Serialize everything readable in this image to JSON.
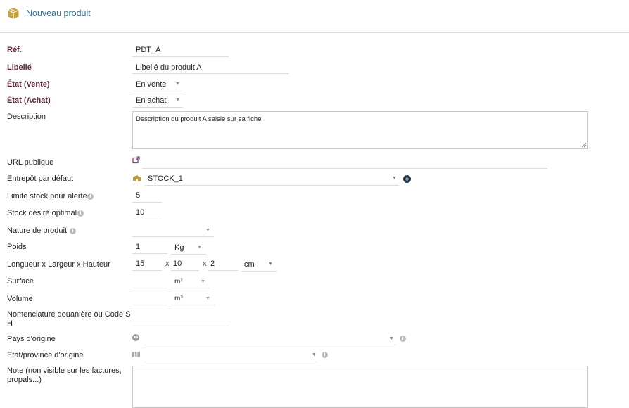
{
  "header": {
    "title": "Nouveau produit",
    "icon": "package-icon"
  },
  "form": {
    "ref": {
      "label": "Réf.",
      "value": "PDT_A"
    },
    "libelle": {
      "label": "Libellé",
      "value": "Libellé du produit A"
    },
    "etat_vente": {
      "label": "État (Vente)",
      "value": "En vente"
    },
    "etat_achat": {
      "label": "État (Achat)",
      "value": "En achat"
    },
    "description": {
      "label": "Description",
      "value": "Description du produit A saisie sur sa fiche"
    },
    "url": {
      "label": "URL publique",
      "icon": "external-link-icon"
    },
    "entrepot": {
      "label": "Entrepôt par défaut",
      "value": "STOCK_1",
      "icon": "warehouse-icon",
      "add_icon": "plus-circle-icon"
    },
    "limite_stock": {
      "label": "Limite stock pour alerte",
      "value": "5"
    },
    "stock_desire": {
      "label": "Stock désiré optimal",
      "value": "10"
    },
    "nature": {
      "label": "Nature de produit",
      "value": ""
    },
    "poids": {
      "label": "Poids",
      "value": "1",
      "unit": "Kg"
    },
    "dimensions": {
      "label": "Longueur x Largeur x Hauteur",
      "length": "15",
      "width": "10",
      "height": "2",
      "sep": "x",
      "unit": "cm"
    },
    "surface": {
      "label": "Surface",
      "value": "",
      "unit": "m²"
    },
    "volume": {
      "label": "Volume",
      "value": "",
      "unit": "m³"
    },
    "douane": {
      "label_line1": "Nomenclature douanière ou Code S",
      "label_line2": "H",
      "value": ""
    },
    "pays": {
      "label": "Pays d'origine",
      "value": "",
      "icon": "globe-icon"
    },
    "etat_province": {
      "label": "Etat/province d'origine",
      "value": "",
      "icon": "map-icon"
    },
    "note": {
      "label_line1": "Note (non visible sur les factures,",
      "label_line2": "propals...)"
    }
  },
  "colors": {
    "required_label": "#5a1e34",
    "header_title": "#3a6e8f",
    "icon_gold": "#c8a03b",
    "icon_purple": "#7b4a6e",
    "plus_icon": "#20364e"
  }
}
